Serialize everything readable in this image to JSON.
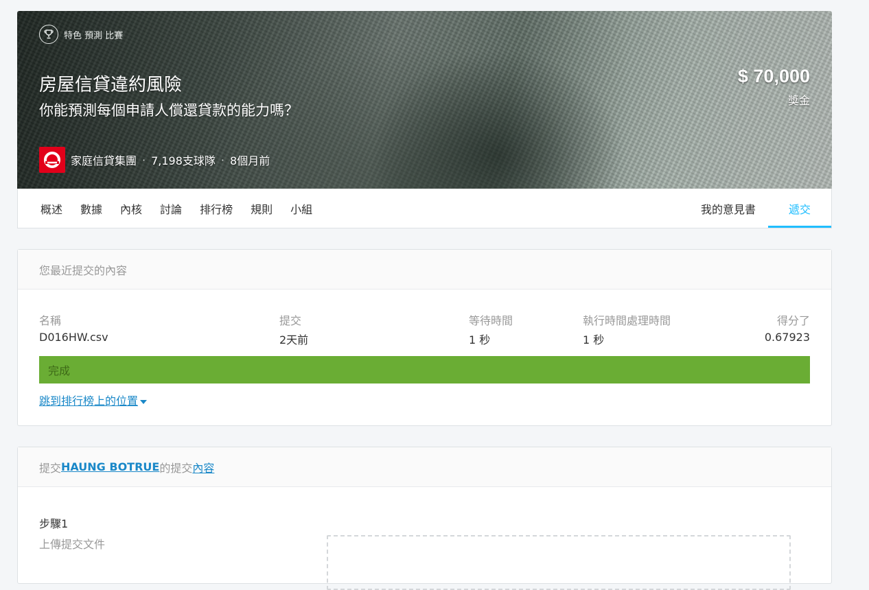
{
  "banner": {
    "badge": "特色 預測 比賽",
    "title": "房屋信貸違約風險",
    "subtitle": "你能預測每個申請人償還貸款的能力嗎？",
    "host_name": "家庭信貸集團",
    "teams": "7,198支球隊",
    "time_ago": "8個月前",
    "separator": "·",
    "prize_amount": "$ 70,000",
    "prize_label": "獎金"
  },
  "nav": {
    "tabs": [
      "概述",
      "數據",
      "內核",
      "討論",
      "排行榜",
      "規則",
      "小組"
    ],
    "my_notes": "我的意見書",
    "submit": "遞交"
  },
  "recent": {
    "header": "您最近提交的內容",
    "columns": {
      "name": "名稱",
      "submitted": "提交",
      "wait_time": "等待時間",
      "run_time": "執行時間處理時間",
      "score": "得分了"
    },
    "row": {
      "name": "D016HW.csv",
      "submitted": "2天前",
      "wait_time": "1 秒",
      "run_time": "1 秒",
      "score": "0.67923"
    },
    "status": "完成",
    "jump_link": "跳到排行榜上的位置"
  },
  "submission": {
    "header_prefix": "提交",
    "team_name": "HAUNG BOTRUE",
    "header_mid": "的提交",
    "header_link": "內容",
    "step_title": "步驟1",
    "step_sub": "上傳提交文件"
  },
  "colors": {
    "accent": "#20beff",
    "success": "#6aad34",
    "link": "#1a88c8",
    "host_logo": "#e2001a"
  }
}
